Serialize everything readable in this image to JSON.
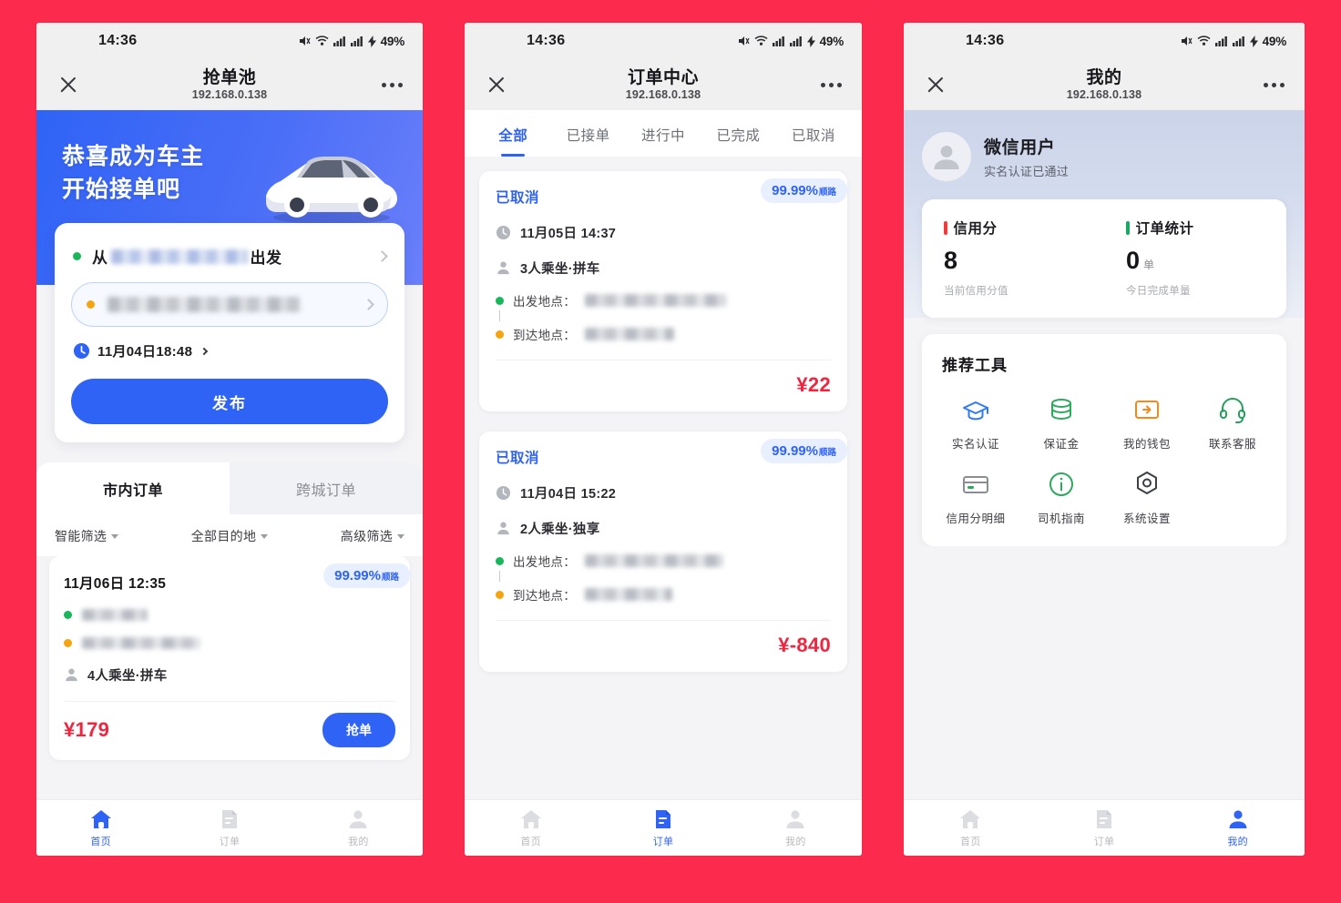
{
  "statusbar": {
    "time": "14:36",
    "battery": "49%"
  },
  "phone1": {
    "nav": {
      "title": "抢单池",
      "subtitle": "192.168.0.138"
    },
    "hero": {
      "line1": "恭喜成为车主",
      "line2": "开始接单吧"
    },
    "form": {
      "from_prefix": "从",
      "from_suffix": "出发",
      "time": "11月04日18:48",
      "publish": "发布"
    },
    "segments": [
      {
        "label": "市内订单",
        "active": true
      },
      {
        "label": "跨城订单",
        "active": false
      }
    ],
    "filters": [
      {
        "label": "智能筛选"
      },
      {
        "label": "全部目的地"
      },
      {
        "label": "高级筛选"
      }
    ],
    "order": {
      "date": "11月06日 12:35",
      "badge_value": "99.99%",
      "badge_unit": "顺路",
      "passengers": "4人乘坐·拼车",
      "price": "¥179",
      "grab": "抢单"
    },
    "tabbar": [
      {
        "label": "首页",
        "icon": "home-icon",
        "active": true
      },
      {
        "label": "订单",
        "icon": "orders-icon",
        "active": false
      },
      {
        "label": "我的",
        "icon": "profile-icon",
        "active": false
      }
    ]
  },
  "phone2": {
    "nav": {
      "title": "订单中心",
      "subtitle": "192.168.0.138"
    },
    "tabs": [
      {
        "label": "全部",
        "active": true
      },
      {
        "label": "已接单",
        "active": false
      },
      {
        "label": "进行中",
        "active": false
      },
      {
        "label": "已完成",
        "active": false
      },
      {
        "label": "已取消",
        "active": false
      }
    ],
    "labels": {
      "origin": "出发地点：",
      "destination": "到达地点："
    },
    "orders": [
      {
        "status": "已取消",
        "badge_value": "99.99%",
        "badge_unit": "顺路",
        "time": "11月05日 14:37",
        "passengers": "3人乘坐·拼车",
        "price": "¥22"
      },
      {
        "status": "已取消",
        "badge_value": "99.99%",
        "badge_unit": "顺路",
        "time": "11月04日 15:22",
        "passengers": "2人乘坐·独享",
        "price": "¥-840"
      }
    ],
    "tabbar": [
      {
        "label": "首页",
        "icon": "home-icon",
        "active": false
      },
      {
        "label": "订单",
        "icon": "orders-icon",
        "active": true
      },
      {
        "label": "我的",
        "icon": "profile-icon",
        "active": false
      }
    ]
  },
  "phone3": {
    "nav": {
      "title": "我的",
      "subtitle": "192.168.0.138"
    },
    "user": {
      "name": "微信用户",
      "verify": "实名认证已通过"
    },
    "stats": [
      {
        "title": "信用分",
        "value": "8",
        "unit": "",
        "note": "当前信用分值",
        "color": "#ef3b3b"
      },
      {
        "title": "订单统计",
        "value": "0",
        "unit": "单",
        "note": "今日完成单量",
        "color": "#16a864"
      }
    ],
    "tools_title": "推荐工具",
    "tools": [
      {
        "label": "实名认证",
        "icon": "graduation-cap-icon",
        "color": "#2f7bf5"
      },
      {
        "label": "保证金",
        "icon": "coins-icon",
        "color": "#2fa85f"
      },
      {
        "label": "我的钱包",
        "icon": "wallet-icon",
        "color": "#f08a1e"
      },
      {
        "label": "联系客服",
        "icon": "headset-icon",
        "color": "#23a05c"
      },
      {
        "label": "信用分明细",
        "icon": "card-icon",
        "color": "#8a8d94"
      },
      {
        "label": "司机指南",
        "icon": "info-circle-icon",
        "color": "#2fa85f"
      },
      {
        "label": "系统设置",
        "icon": "gear-icon",
        "color": "#3c3f45"
      }
    ],
    "tabbar": [
      {
        "label": "首页",
        "icon": "home-icon",
        "active": false
      },
      {
        "label": "订单",
        "icon": "orders-icon",
        "active": false
      },
      {
        "label": "我的",
        "icon": "profile-icon",
        "active": true
      }
    ]
  }
}
